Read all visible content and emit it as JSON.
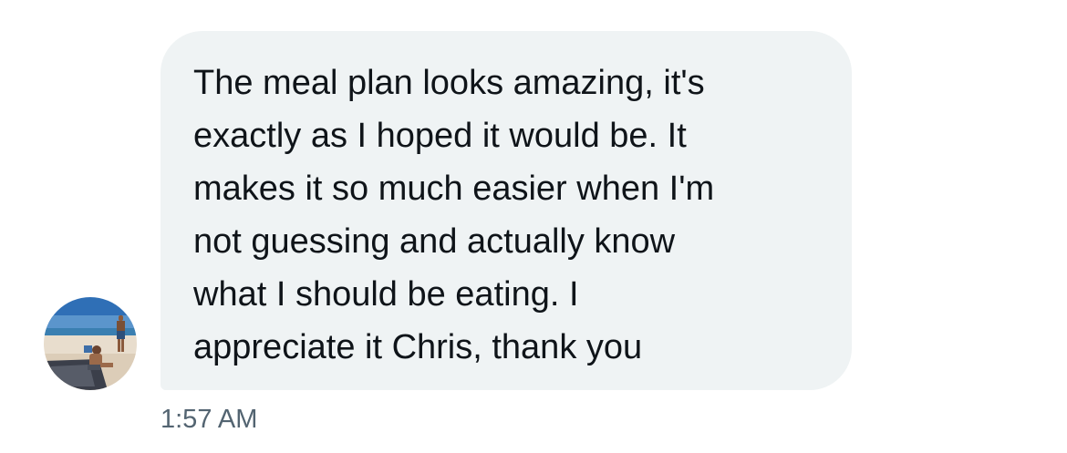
{
  "message": {
    "text": "The meal plan looks amazing, it's\nexactly as I hoped it would be. It\nmakes it so much easier when I'm\nnot guessing and actually know\nwhat I should be eating. I\nappreciate it Chris, thank you",
    "timestamp": "1:57 AM"
  },
  "sender": {
    "avatar": "beach-photo-avatar"
  },
  "colors": {
    "bubble_bg": "#eff3f4",
    "text": "#0f1419",
    "timestamp": "#536471"
  }
}
